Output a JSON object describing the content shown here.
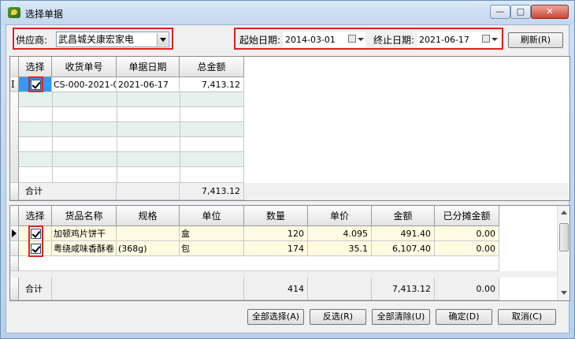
{
  "window": {
    "title": "选择单据"
  },
  "filters": {
    "supplier_label": "供应商:",
    "supplier_value": "武昌城关康宏家电",
    "start_label": "起始日期:",
    "start_value": "2014-03-01",
    "end_label": "终止日期:",
    "end_value": "2021-06-17",
    "refresh_label": "刷新(R)"
  },
  "doc_grid": {
    "headers": [
      "选择",
      "收货单号",
      "单据日期",
      "总金额"
    ],
    "rows": [
      {
        "checked": true,
        "no": "CS-000-2021-0",
        "date": "2021-06-17",
        "total": "7,413.12"
      }
    ],
    "sum_label": "合计",
    "sum_total": "7,413.12"
  },
  "item_grid": {
    "headers": [
      "选择",
      "货品名称",
      "规格",
      "单位",
      "数量",
      "单价",
      "金额",
      "已分摊金额"
    ],
    "rows": [
      {
        "checked": true,
        "name": "加顿鸡片饼干",
        "spec": "",
        "unit": "盒",
        "qty": "120",
        "price": "4.095",
        "amount": "491.40",
        "alloc": "0.00"
      },
      {
        "checked": true,
        "name": "粤绕咸味香酥卷",
        "spec": "(368g)",
        "unit": "包",
        "qty": "174",
        "price": "35.1",
        "amount": "6,107.40",
        "alloc": "0.00"
      }
    ],
    "sum_label": "合计",
    "sum_qty": "414",
    "sum_amount": "7,413.12",
    "sum_alloc": "0.00"
  },
  "buttons": {
    "select_all": "全部选择(A)",
    "invert": "反选(R)",
    "clear_all": "全部清除(U)",
    "ok": "确定(D)",
    "cancel": "取消(C)"
  },
  "colors": {
    "highlight": "#e02020",
    "title_bg": "#c3d7ee",
    "row_alt": "#e6f0ec",
    "row_yellow": "#fffbe3"
  }
}
